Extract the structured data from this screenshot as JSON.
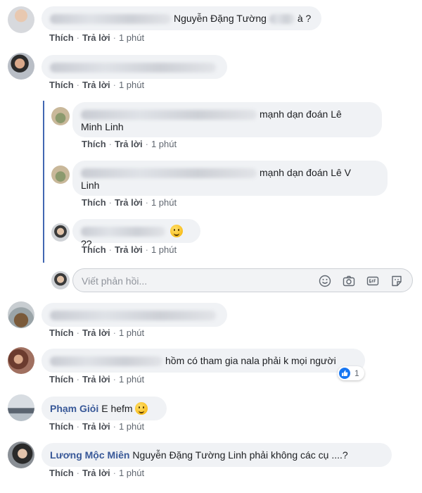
{
  "actions": {
    "like": "Thích",
    "reply": "Trả lời",
    "separator": "·",
    "time": "1 phút"
  },
  "comments": [
    {
      "text": "Nguyễn Đặng Tường",
      "suffix": "à ?"
    },
    {
      "text": ""
    },
    {
      "text": ""
    },
    {
      "text": ""
    },
    {
      "text": ""
    },
    {
      "name": "Phạm Giỏi",
      "text": "E hefm"
    },
    {
      "name": "Lương Mộc Miên",
      "text": "Nguyễn Đặng Tường Linh phải không các cụ ....?"
    }
  ],
  "replies": [
    {
      "text": "mạnh dạn đoán Lê",
      "text2": "Minh Linh"
    },
    {
      "text": "mạnh dạn đoán Lê V",
      "text2": "Linh"
    },
    {
      "text": "??"
    }
  ],
  "comment_5": {
    "text": "hồm có tham gia nala phải k mọi người",
    "reaction_count": "1"
  },
  "reply_box": {
    "placeholder": "Viết phản hồi..."
  },
  "icons": [
    "emoji-icon",
    "camera-icon",
    "gif-icon",
    "sticker-icon",
    "like-reaction-icon"
  ],
  "colors": {
    "bubble": "#f0f2f5",
    "name": "#385898",
    "thread_line": "#4267b2",
    "like": "#1877f2"
  }
}
